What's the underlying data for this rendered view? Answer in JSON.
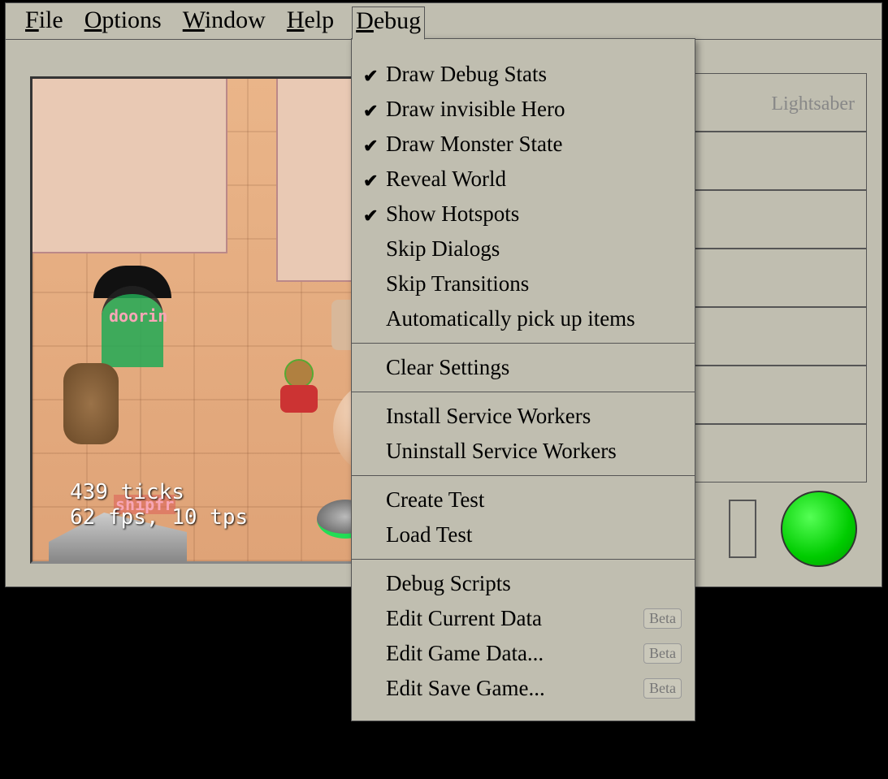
{
  "menubar": {
    "file": "File",
    "options": "Options",
    "window": "Window",
    "help": "Help",
    "debug": "Debug"
  },
  "debug_menu": {
    "draw_debug_stats": "Draw Debug Stats",
    "draw_invisible_hero": "Draw invisible Hero",
    "draw_monster_state": "Draw Monster State",
    "reveal_world": "Reveal World",
    "show_hotspots": "Show Hotspots",
    "skip_dialogs": "Skip Dialogs",
    "skip_transitions": "Skip Transitions",
    "auto_pickup": "Automatically pick up items",
    "clear_settings": "Clear Settings",
    "install_sw": "Install Service Workers",
    "uninstall_sw": "Uninstall Service Workers",
    "create_test": "Create Test",
    "load_test": "Load Test",
    "debug_scripts": "Debug Scripts",
    "edit_current_data": "Edit Current Data",
    "edit_game_data": "Edit Game Data...",
    "edit_save_game": "Edit Save Game...",
    "beta_badge": "Beta",
    "checked": {
      "draw_debug_stats": true,
      "draw_invisible_hero": true,
      "draw_monster_state": true,
      "reveal_world": true,
      "show_hotspots": true,
      "skip_dialogs": false,
      "skip_transitions": false,
      "auto_pickup": false
    }
  },
  "game": {
    "hotspots": {
      "doorin": "doorin",
      "shipfr": "shipfr"
    },
    "stats_line1": "439 ticks",
    "stats_line2": "62 fps, 10 tps",
    "ticks": 439,
    "fps": 62,
    "tps": 10
  },
  "inventory": {
    "item0": "Lightsaber"
  }
}
